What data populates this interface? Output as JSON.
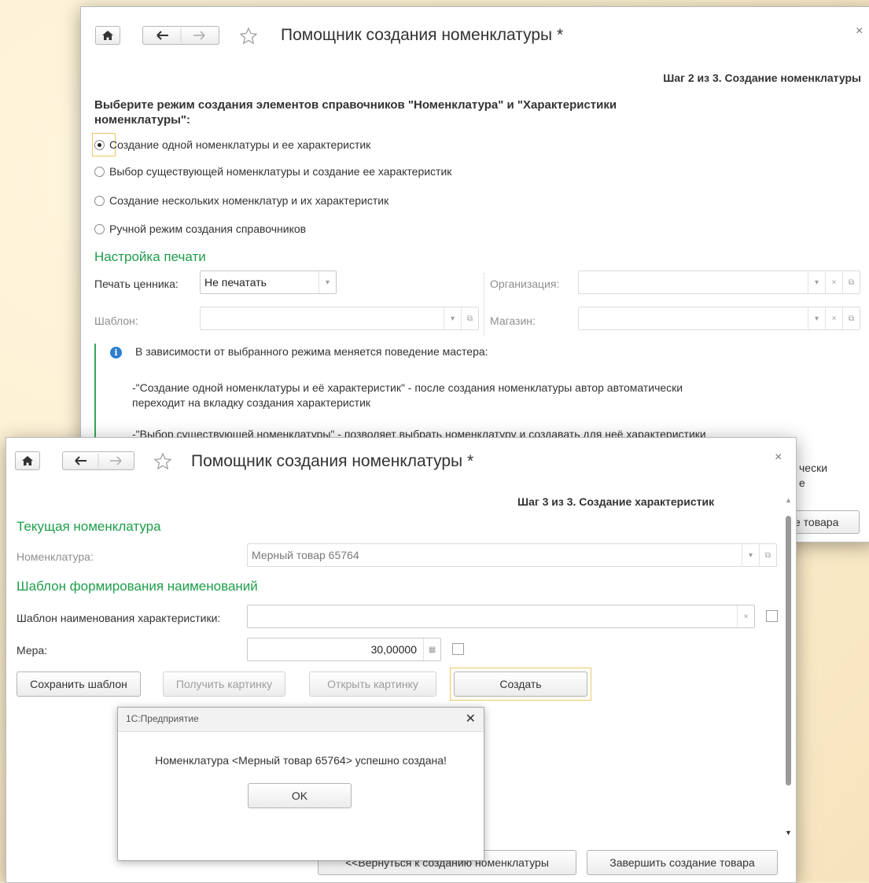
{
  "window1": {
    "title": "Помощник создания номенклатуры *",
    "step": "Шаг 2 из 3. Создание номенклатуры",
    "mode_heading_line1": "Выберите режим создания элементов справочников \"Номенклатура\" и \"Характеристики",
    "mode_heading_line2": "номенклатуры\":",
    "options": [
      "Создание одной номенклатуры и ее характеристик",
      "Выбор существующей номенклатуры и создание ее характеристик",
      "Создание нескольких номенклатур и их характеристик",
      "Ручной режим создания справочников"
    ],
    "selected_option": 0,
    "print_section": "Настройка печати",
    "price_print_label": "Печать ценника:",
    "price_print_value": "Не печатать",
    "template_label": "Шаблон:",
    "organization_label": "Организация:",
    "store_label": "Магазин:",
    "info_line1": "В зависимости от выбранного режима меняется поведение мастера:",
    "info_line2": "-\"Создание одной номенклатуры и её характеристик\" - после создания номенклатуры автор автоматически",
    "info_line3": "переходит на вкладку создания характеристик",
    "info_line4": "-\"Выбор существующей номенклатуры\" - позволяет выбрать номенклатуру и создавать для неё характеристики",
    "info_partial_line5": "чески",
    "info_partial_line6": "е",
    "partial_button": "е товара"
  },
  "window2": {
    "title": "Помощник создания номенклатуры *",
    "step": "Шаг 3 из 3. Создание характеристик",
    "current_section": "Текущая номенклатура",
    "nomenclature_label": "Номенклатура:",
    "nomenclature_value": "Мерный товар 65764",
    "template_section": "Шаблон формирования наименований",
    "char_template_label": "Шаблон наименования характеристики:",
    "char_template_value": "",
    "measure_label": "Мера:",
    "measure_value": "30,00000",
    "buttons": {
      "save_template": "Сохранить шаблон",
      "get_image": "Получить картинку",
      "open_image": "Открыть картинку",
      "create": "Создать",
      "back": "<<Вернуться к созданию номенклатуры",
      "finish": "Завершить создание товара"
    }
  },
  "dialog": {
    "title": "1С:Предприятие",
    "message": "Номенклатура <Мерный товар 65764> успешно создана!",
    "ok": "OK"
  },
  "colors": {
    "section_green": "#1e9e4a",
    "focus_yellow": "#f0c860",
    "info_blue": "#2d7fcf"
  }
}
